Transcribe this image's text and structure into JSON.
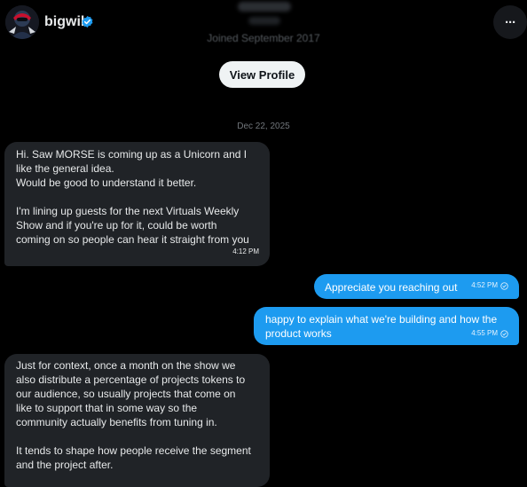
{
  "header": {
    "username": "bigwil",
    "joined": "Joined September 2017",
    "more_label": "···"
  },
  "profile_button_label": "View Profile",
  "date_separator": "Dec 22, 2025",
  "messages": [
    {
      "direction": "incoming",
      "text": "Hi. Saw MORSE is coming up as a Unicorn and I\nlike the general idea.\nWould be good to understand it better.\n\nI'm lining up guests for the next Virtuals Weekly\nShow and if you're up for it, could be worth\ncoming on so people can hear it straight from you",
      "time": "4:12 PM"
    },
    {
      "direction": "outgoing",
      "text": "Appreciate you reaching out",
      "time": "4:52 PM"
    },
    {
      "direction": "outgoing",
      "text": "happy to explain what we're building and how the\nproduct works",
      "time": "4:55 PM"
    },
    {
      "direction": "incoming",
      "text": "Just for context, once a month on the show we\nalso distribute a percentage of projects tokens to\nour audience, so usually projects that come on\nlike to support that in some way so the\ncommunity actually benefits from tuning in.\n\nIt tends to shape how people receive the segment\nand the project after."
    }
  ],
  "colors": {
    "background": "#000000",
    "incoming_bubble": "#202327",
    "outgoing_bubble": "#1d9bf0",
    "verified": "#1d9bf0"
  }
}
